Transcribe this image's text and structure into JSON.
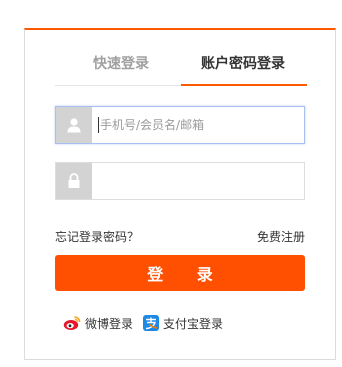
{
  "tabs": {
    "quick_login": "快速登录",
    "account_login": "账户密码登录"
  },
  "username": {
    "placeholder": "手机号/会员名/邮箱",
    "value": ""
  },
  "password": {
    "placeholder": "",
    "value": ""
  },
  "links": {
    "forgot_password": "忘记登录密码？",
    "register": "免费注册"
  },
  "login_button": "登 录",
  "social": {
    "weibo": "微博登录",
    "alipay": "支付宝登录"
  },
  "colors": {
    "accent": "#ff4f00",
    "icon_box": "#d3d3d3"
  },
  "icons": {
    "username": "user-icon",
    "password": "lock-icon",
    "weibo": "weibo-icon",
    "alipay": "alipay-icon"
  }
}
